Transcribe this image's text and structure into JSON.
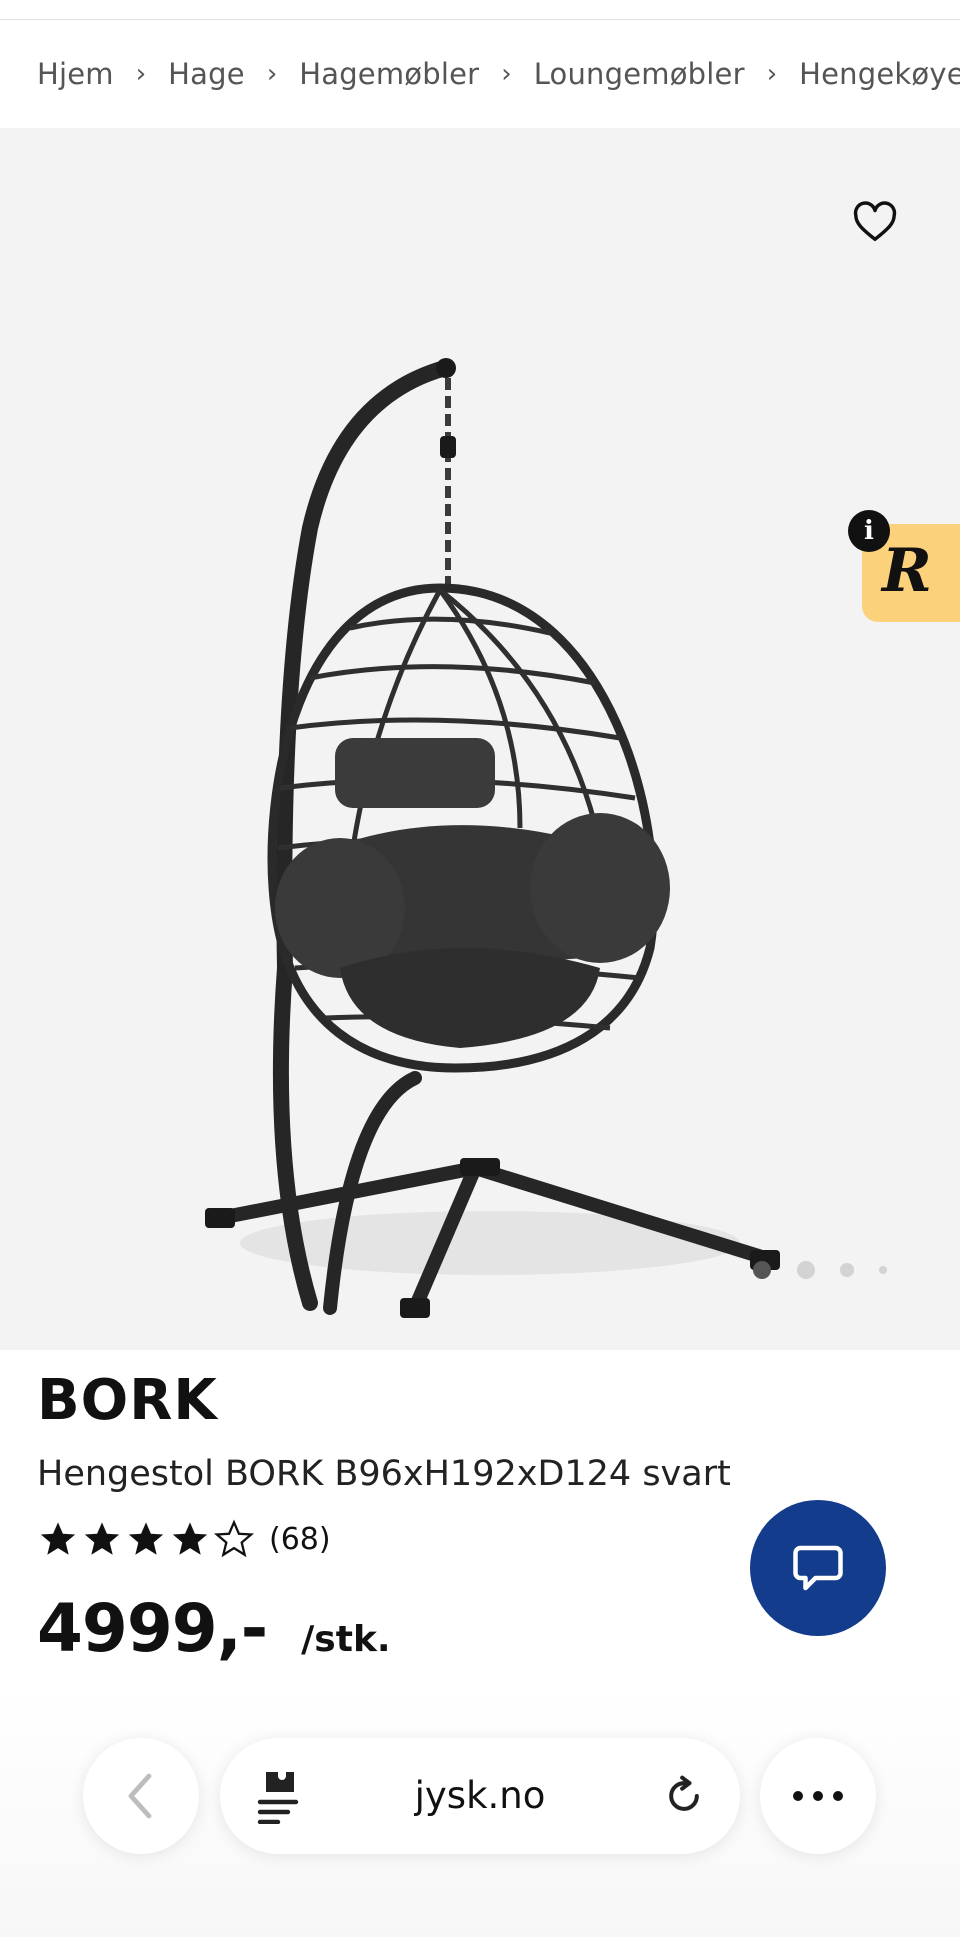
{
  "breadcrumb": [
    "Hjem",
    "Hage",
    "Hagemøbler",
    "Loungemøbler",
    "Hengekøyer"
  ],
  "breadcrumb_separator": "›",
  "gallery": {
    "image_subject": "hanging egg chair, black",
    "slide_count": 4,
    "active_slide": 1
  },
  "badge": {
    "letter": "R",
    "info_glyph": "i",
    "color": "#fbd27b"
  },
  "product": {
    "brand": "BORK",
    "title": "Hengestol BORK B96xH192xD124 svart",
    "rating": 4,
    "rating_max": 5,
    "review_count": "(68)",
    "price": "4999,-",
    "unit": "/stk."
  },
  "chat": {
    "icon": "chat-bubble-icon",
    "color": "#143c8c"
  },
  "browser": {
    "url": "jysk.no",
    "back_icon": "chevron-left-icon",
    "reader_icon": "puzzle-icon",
    "reload_icon": "reload-icon",
    "more_icon": "more-icon"
  }
}
